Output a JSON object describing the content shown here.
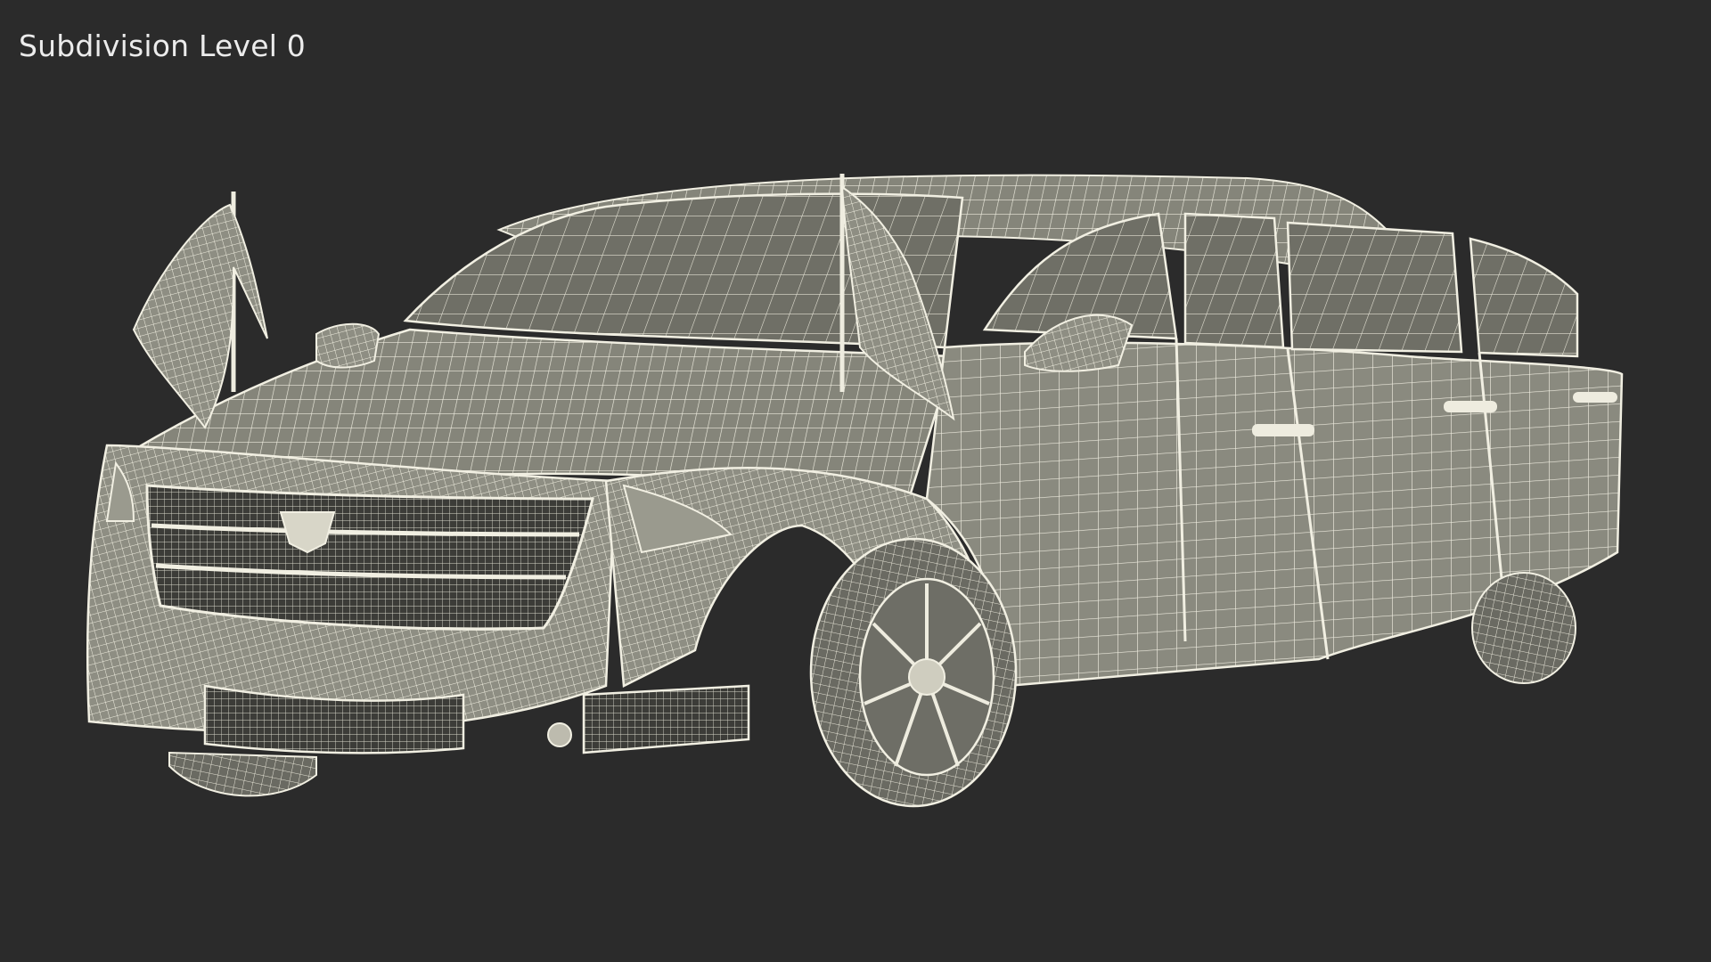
{
  "caption": "Subdivision Level 0",
  "colors": {
    "background": "#2b2b2b",
    "surface": "#8a8a7e",
    "surface_dark": "#5c5c54",
    "wire": "#f1efe2",
    "caption": "#ececec"
  },
  "icons": {
    "model": "wireframe-limousine"
  }
}
